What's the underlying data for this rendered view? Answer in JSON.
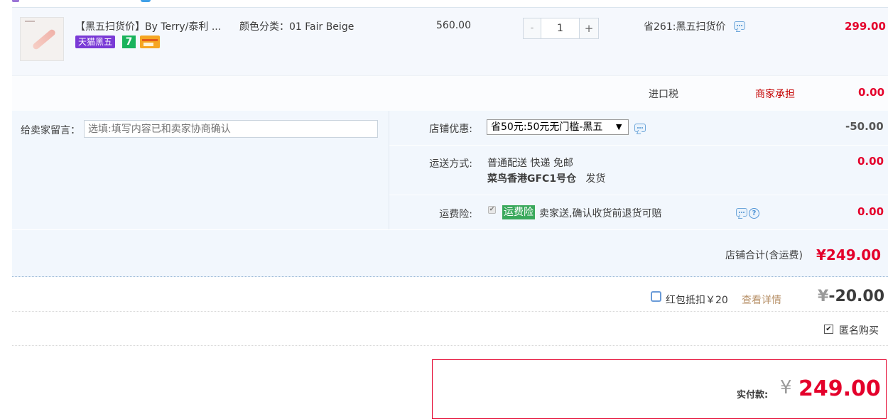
{
  "item": {
    "title": "【黑五扫货价】By Terry/泰利 ...",
    "sku": "颜色分类：01 Fair Beige",
    "badges": [
      "天猫黑五",
      "7"
    ],
    "price": "560.00",
    "quantity": "1",
    "qty_minus": "-",
    "qty_plus": "+",
    "promo": "省261:黑五扫货价",
    "subtotal": "299.00"
  },
  "tax": {
    "label": "进口税",
    "value": "商家承担",
    "amount": "0.00"
  },
  "message": {
    "label": "给卖家留言：",
    "placeholder": "选填:填写内容已和卖家协商确认"
  },
  "shop_coupon": {
    "label": "店铺优惠:",
    "selected": "省50元:50元无门槛-黑五",
    "amount": "-50.00"
  },
  "shipping": {
    "label": "运送方式:",
    "method": "普通配送 快递 免邮",
    "warehouse": "菜鸟香港GFC1号仓",
    "dispatch": "发货",
    "amount": "0.00"
  },
  "insurance": {
    "label": "运费险:",
    "tag": "运费险",
    "text": "卖家送,确认收货前退货可赔",
    "amount": "0.00"
  },
  "shop_total": {
    "label": "店铺合计(含运费)",
    "value": "¥249.00"
  },
  "red_packet": {
    "label": "红包抵扣￥20",
    "detail_link": "查看详情",
    "yen": "¥",
    "amount": "-20.00"
  },
  "anonymous": {
    "label": "匿名购买",
    "checked": true
  },
  "payment": {
    "label": "实付款:",
    "yen": "¥",
    "value": "249.00"
  },
  "colors": {
    "accent_red": "#e4002b",
    "panel_blue": "#f2f7fd",
    "insurance_green": "#3aa95c",
    "tmall_purple": "#7a3ad6"
  }
}
